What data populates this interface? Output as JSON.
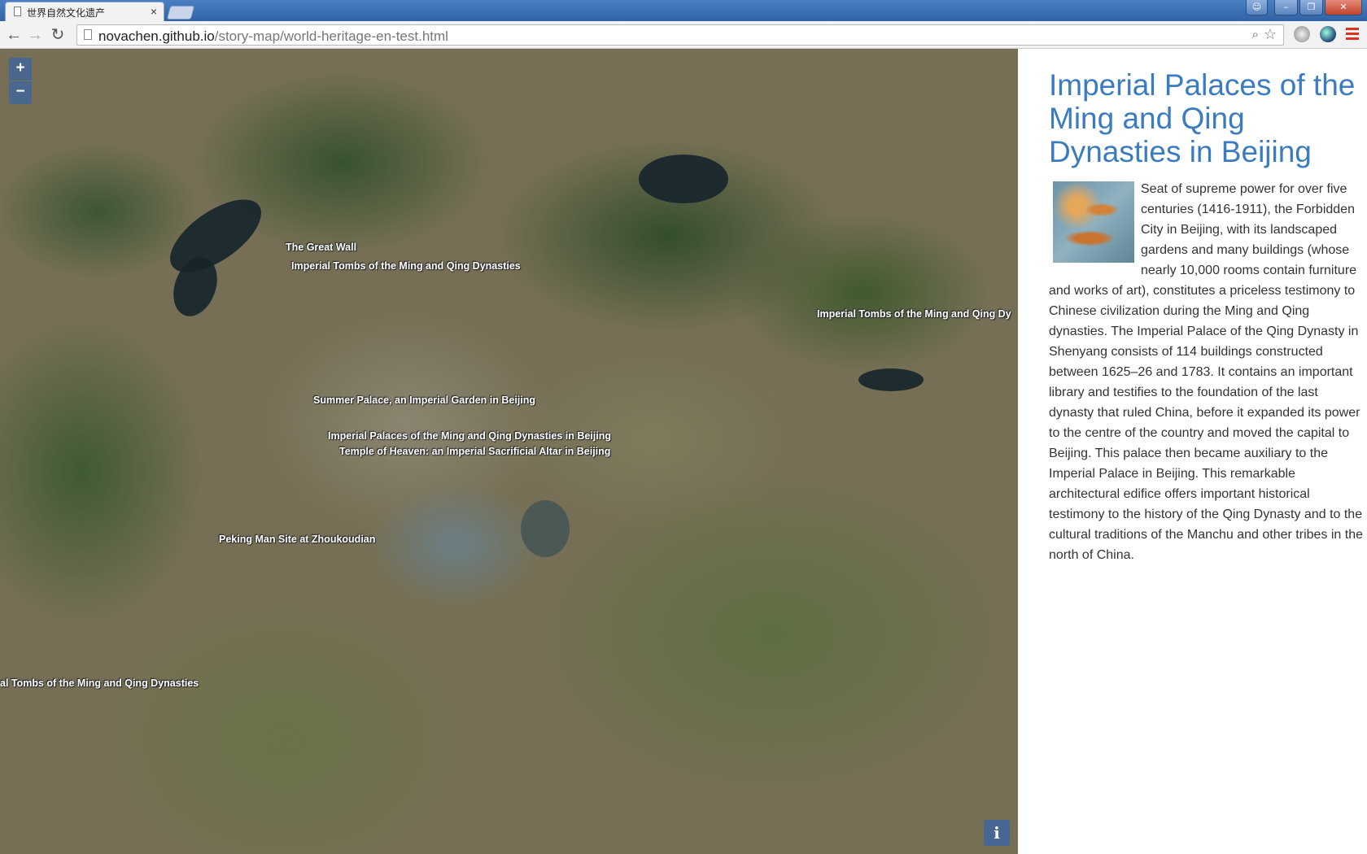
{
  "browser": {
    "tab_title": "世界自然文化遗产",
    "url_host": "novachen.github.io",
    "url_path": "/story-map/world-heritage-en-test.html"
  },
  "map": {
    "zoom_in_label": "+",
    "zoom_out_label": "−",
    "info_label": "i",
    "labels": [
      "The Great Wall",
      "Imperial Tombs of the Ming and Qing Dynasties",
      "Imperial Tombs of the Ming and Qing Dy",
      "Summer Palace, an Imperial Garden in Beijing",
      "Imperial Palaces of the Ming and Qing Dynasties in Beijing",
      "Temple of Heaven: an Imperial Sacrificial Altar in Beijing",
      "Peking Man Site at Zhoukoudian",
      "al Tombs of the Ming and Qing Dynasties"
    ]
  },
  "panel": {
    "title": "Imperial Palaces of the Ming and Qing Dynasties in Beijing",
    "description": "Seat of supreme power for over five centuries (1416-1911), the Forbidden City in Beijing, with its landscaped gardens and many buildings (whose nearly 10,000 rooms contain furniture and works of art), constitutes a priceless testimony to Chinese civilization during the Ming and Qing dynasties. The Imperial Palace of the Qing Dynasty in Shenyang consists of 114 buildings constructed between 1625–26 and 1783. It contains an important library and testifies to the foundation of the last dynasty that ruled China, before it expanded its power to the centre of the country and moved the capital to Beijing. This palace then became auxiliary to the Imperial Palace in Beijing. This remarkable architectural edifice offers important historical testimony to the history of the Qing Dynasty and to the cultural traditions of the Manchu and other tribes in the north of China."
  },
  "colors": {
    "title_blue": "#3b7cc0",
    "map_control": "#3c64a0"
  }
}
